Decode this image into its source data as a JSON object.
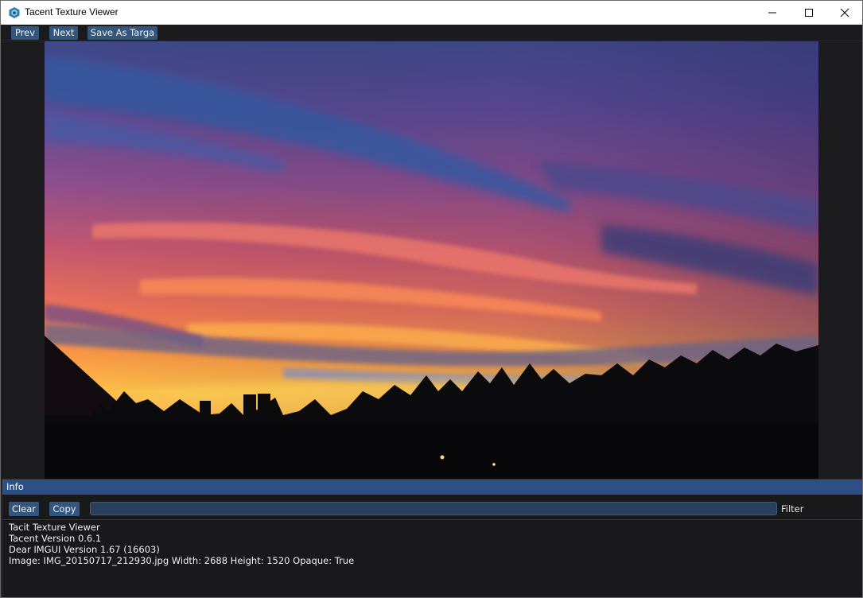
{
  "window": {
    "title": "Tacent Texture Viewer",
    "controls": [
      "minimize-icon",
      "maximize-icon",
      "close-icon"
    ]
  },
  "toolbar": {
    "prev_label": "Prev",
    "next_label": "Next",
    "save_label": "Save As Targa",
    "button_color": "#33567f"
  },
  "image": {
    "subject": "sunset sky over treeline silhouette"
  },
  "info": {
    "header": "Info",
    "clear_label": "Clear",
    "copy_label": "Copy",
    "filter_value": "",
    "filter_label": "Filter",
    "header_color": "#2c4f86",
    "log": [
      "Tacit Texture Viewer",
      "Tacent Version 0.6.1",
      "Dear IMGUI Version 1.67 (16603)",
      "Image: IMG_20150717_212930.jpg Width: 2688 Height: 1520 Opaque: True"
    ]
  }
}
